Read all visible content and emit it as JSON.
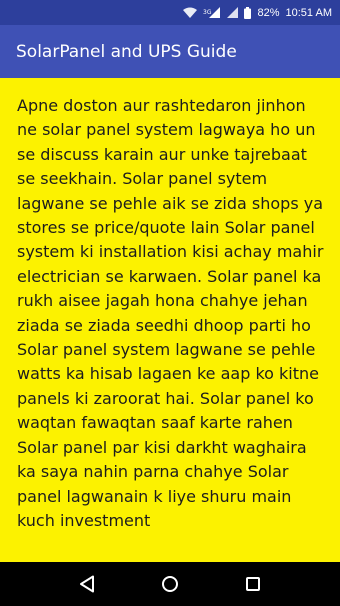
{
  "status_bar": {
    "signal_text": "3G",
    "battery_percent": "82%",
    "time": "10:51 AM"
  },
  "app_bar": {
    "title": "SolarPanel and UPS Guide"
  },
  "content": {
    "body": "Apne doston aur rashtedaron jinhon ne solar panel system lagwaya ho un se discuss karain aur unke tajrebaat se seekhain. Solar panel sytem lagwane se pehle aik se zida shops ya stores se price/quote lain Solar panel system ki installation kisi achay mahir electrician se karwaen. Solar panel ka rukh aisee jagah hona chahye jehan ziada se ziada seedhi dhoop parti ho Solar panel system lagwane se pehle watts ka hisab lagaen ke aap ko kitne panels ki zaroorat hai. Solar panel ko waqtan fawaqtan saaf karte rahen Solar panel par kisi darkht waghaira ka saya nahin parna chahye Solar panel lagwanain k liye shuru main kuch investment"
  },
  "nav": {
    "back_icon": "back-triangle-icon",
    "home_icon": "home-circle-icon",
    "recents_icon": "recents-square-icon"
  },
  "colors": {
    "status_bar": "#2d3f9c",
    "app_bar": "#3f51b5",
    "content_bg": "#fcf200",
    "text": "#1d1d1d",
    "nav_bar": "#000000"
  }
}
